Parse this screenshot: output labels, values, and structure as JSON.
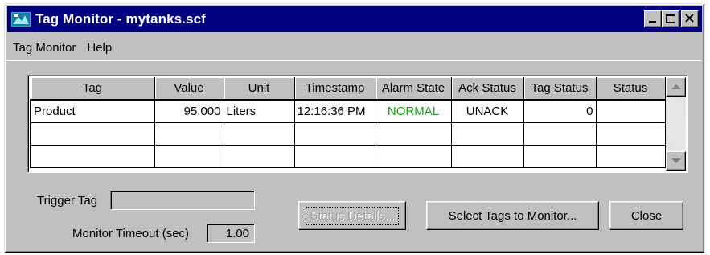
{
  "window": {
    "title": "Tag Monitor - mytanks.scf",
    "titlebar_color": "#000080"
  },
  "icons": {
    "app": "tag-monitor-app-icon",
    "minimize": "minimize-icon",
    "maximize": "maximize-icon",
    "close": "close-icon",
    "scroll_up": "arrow-up-icon",
    "scroll_down": "arrow-down-icon"
  },
  "menu": {
    "items": [
      {
        "label": "Tag Monitor"
      },
      {
        "label": "Help"
      }
    ]
  },
  "grid": {
    "columns": [
      "Tag",
      "Value",
      "Unit",
      "Timestamp",
      "Alarm State",
      "Ack Status",
      "Tag Status",
      "Status"
    ],
    "rows": [
      {
        "tag": "Product",
        "value": "95.000",
        "unit": "Liters",
        "timestamp": "12:16:36 PM",
        "alarm_state": "NORMAL",
        "ack_status": "UNACK",
        "tag_status": "0",
        "status": ""
      },
      {
        "tag": "",
        "value": "",
        "unit": "",
        "timestamp": "",
        "alarm_state": "",
        "ack_status": "",
        "tag_status": "",
        "status": ""
      },
      {
        "tag": "",
        "value": "",
        "unit": "",
        "timestamp": "",
        "alarm_state": "",
        "ack_status": "",
        "tag_status": "",
        "status": ""
      }
    ],
    "alarm_normal_color": "#13a30f"
  },
  "form": {
    "trigger_tag_label": "Trigger Tag",
    "trigger_tag_value": "",
    "monitor_timeout_label": "Monitor Timeout (sec)",
    "monitor_timeout_value": "1.00"
  },
  "buttons": {
    "status_details": "Status Details...",
    "select_tags": "Select Tags to Monitor...",
    "close": "Close"
  }
}
